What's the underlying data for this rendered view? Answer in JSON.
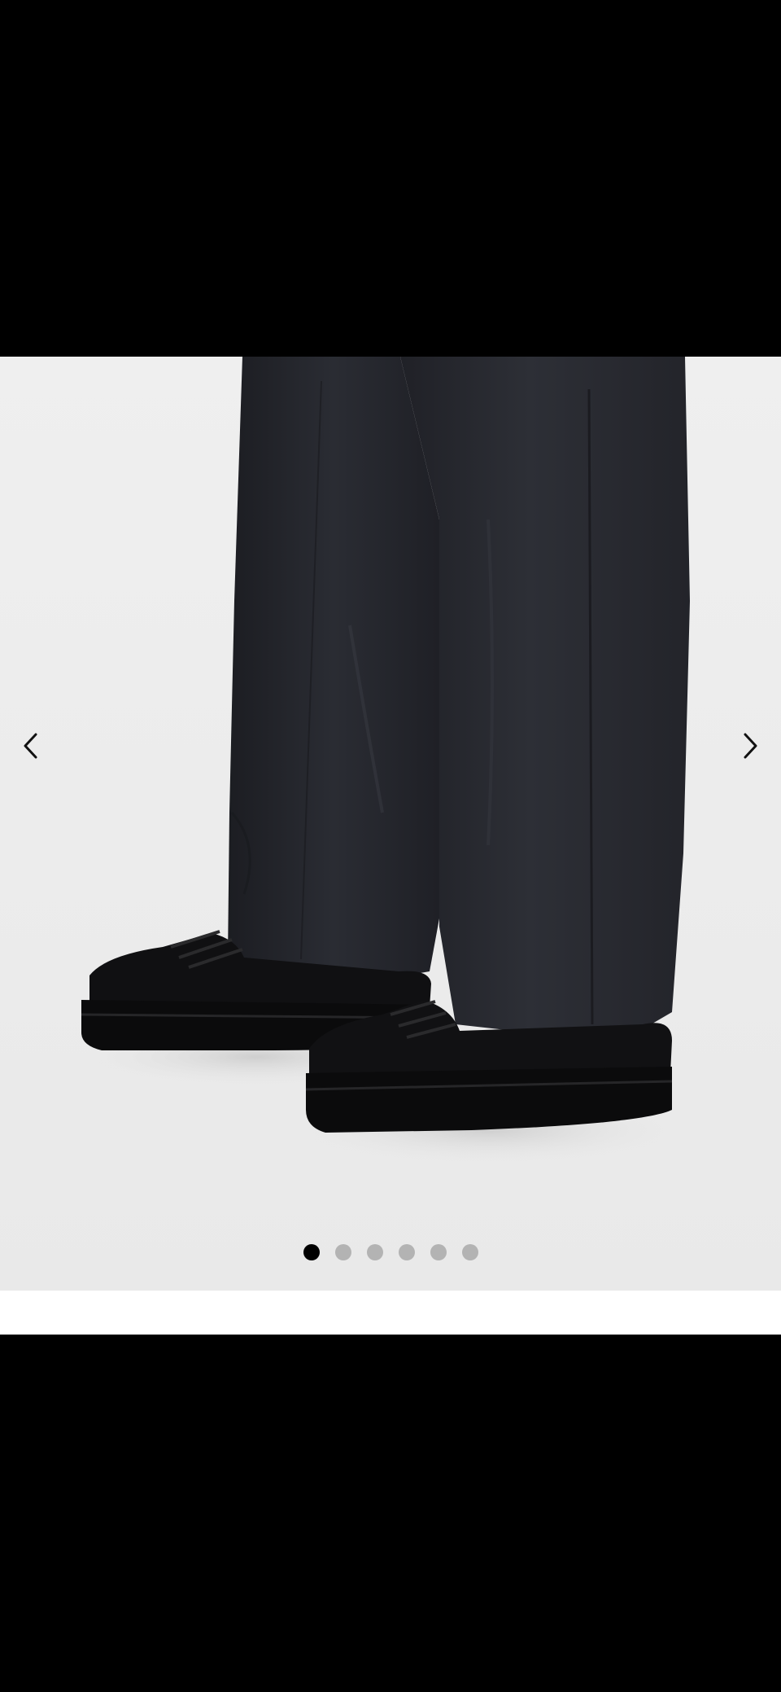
{
  "gallery": {
    "image_description_icon": "product-photo-trousers-sneakers",
    "prev_icon": "chevron-left-icon",
    "next_icon": "chevron-right-icon",
    "total_slides": 6,
    "active_slide": 1,
    "colors": {
      "background": "#ededed",
      "dot_active": "#000000",
      "dot_inactive": "#b3b3b3"
    }
  }
}
